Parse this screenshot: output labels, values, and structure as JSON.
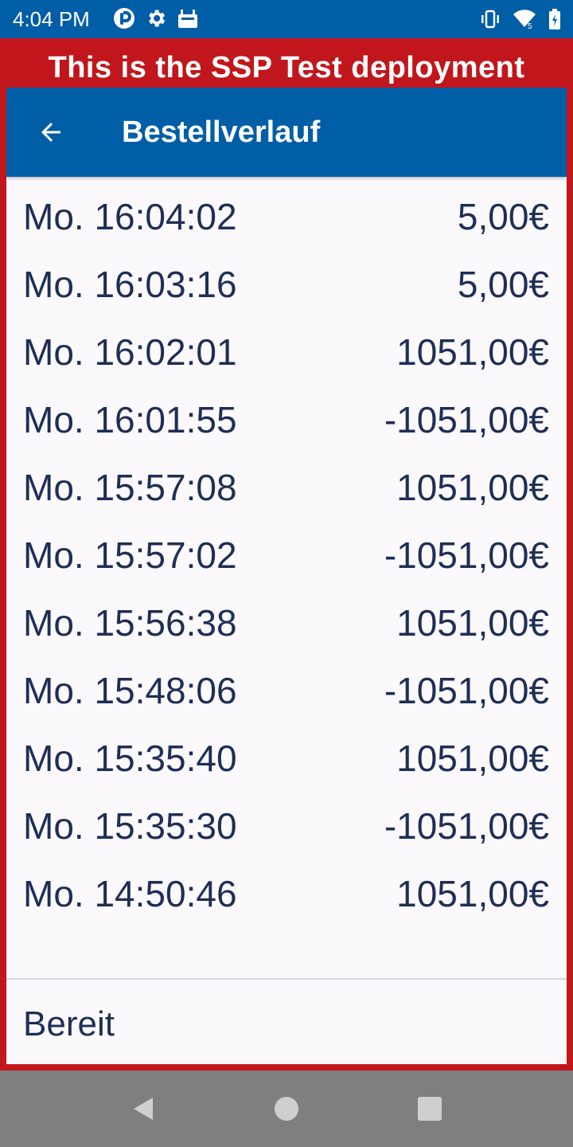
{
  "status_bar": {
    "time": "4:04 PM",
    "left_icons": [
      "app-icon",
      "gear-icon",
      "android-icon"
    ],
    "right_icons": [
      "vibrate-icon",
      "wifi-icon",
      "battery-icon"
    ]
  },
  "banner": {
    "text": "This is the SSP Test deployment"
  },
  "app_bar": {
    "title": "Bestellverlauf",
    "back_icon": "arrow-left-icon"
  },
  "orders": [
    {
      "time": "Mo. 16:04:02",
      "amount": "5,00€"
    },
    {
      "time": "Mo. 16:03:16",
      "amount": "5,00€"
    },
    {
      "time": "Mo. 16:02:01",
      "amount": "1051,00€"
    },
    {
      "time": "Mo. 16:01:55",
      "amount": "-1051,00€"
    },
    {
      "time": "Mo. 15:57:08",
      "amount": "1051,00€"
    },
    {
      "time": "Mo. 15:57:02",
      "amount": "-1051,00€"
    },
    {
      "time": "Mo. 15:56:38",
      "amount": "1051,00€"
    },
    {
      "time": "Mo. 15:48:06",
      "amount": "-1051,00€"
    },
    {
      "time": "Mo. 15:35:40",
      "amount": "1051,00€"
    },
    {
      "time": "Mo. 15:35:30",
      "amount": "-1051,00€"
    },
    {
      "time": "Mo. 14:50:46",
      "amount": "1051,00€"
    }
  ],
  "footer": {
    "status": "Bereit"
  },
  "nav_bar": {
    "icons": [
      "nav-back-icon",
      "nav-home-icon",
      "nav-recents-icon"
    ]
  },
  "colors": {
    "primary": "#005ea6",
    "banner": "#c1171c",
    "text": "#1e2f55",
    "background": "#fcf9fd",
    "nav_bar": "#7f7f7f"
  }
}
